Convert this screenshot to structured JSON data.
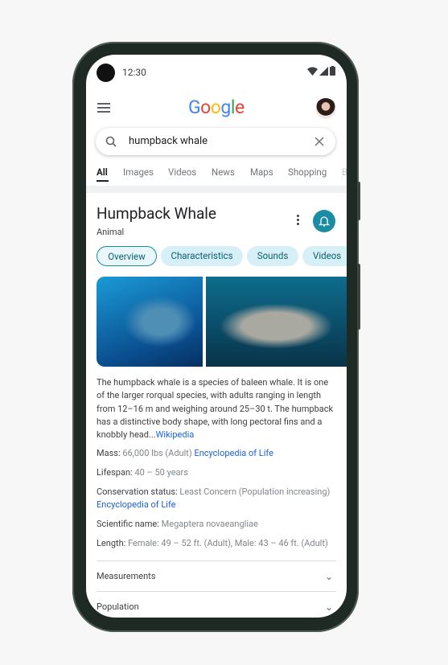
{
  "status": {
    "time": "12:30"
  },
  "header": {
    "logo": "Google",
    "logo_colors": [
      "#4285F4",
      "#EA4335",
      "#FBBC05",
      "#4285F4",
      "#34A853",
      "#EA4335"
    ]
  },
  "search": {
    "query": "humpback whale"
  },
  "tabs": [
    "All",
    "Images",
    "Videos",
    "News",
    "Maps",
    "Shopping",
    "B"
  ],
  "panel": {
    "title": "Humpback Whale",
    "subtitle": "Animal",
    "chips": [
      "Overview",
      "Characteristics",
      "Sounds",
      "Videos"
    ],
    "description": "The humpback whale is a species of baleen whale. It is one of the larger rorqual species, with adults ranging in length from 12–16 m and weighing around 25–30 t. The humpback has a distinctive body shape, with long pectoral fins and a knobbly head...",
    "description_source": "Wikipedia",
    "facts": [
      {
        "label": "Mass:",
        "value": " 66,000 lbs (Adult) ",
        "source": "Encyclopedia of Life"
      },
      {
        "label": "Lifespan:",
        "value": " 40 – 50 years",
        "source": ""
      },
      {
        "label": "Conservation status:",
        "value": " Least Concern (Population increasing)",
        "source": "Encyclopedia of Life"
      },
      {
        "label": "Scientific name:",
        "value": " Megaptera novaeangliae",
        "source": ""
      },
      {
        "label": "Length:",
        "value": " Female: 49 – 52 ft. (Adult), Male: 43 – 46 ft. (Adult)",
        "source": ""
      }
    ],
    "sections": [
      "Measurements",
      "Population"
    ]
  },
  "colors": {
    "accent": "#1a8ca3",
    "link": "#1a62d6"
  }
}
